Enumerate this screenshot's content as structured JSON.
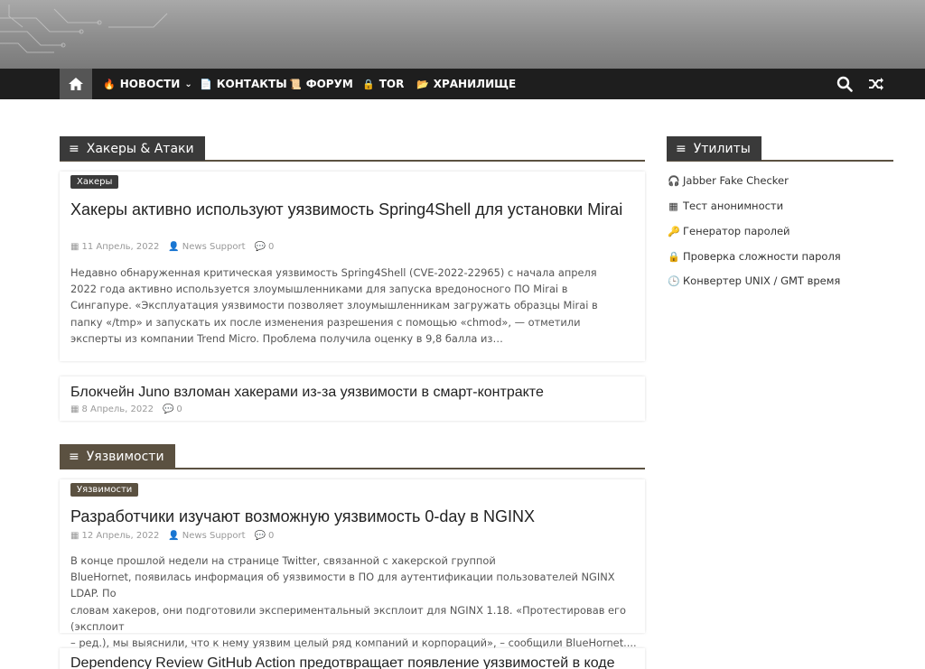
{
  "nav": {
    "items": [
      {
        "label": "НОВОСТИ",
        "icon": "fire-icon",
        "glyph": "🔥",
        "dropdown": "⌄"
      },
      {
        "label": "КОНТАКТЫ",
        "icon": "document-icon",
        "glyph": "📄"
      },
      {
        "label": "ФОРУМ",
        "icon": "scroll-icon",
        "glyph": "📜"
      },
      {
        "label": "TOR",
        "icon": "lock-icon",
        "glyph": "🔒"
      },
      {
        "label": "ХРАНИЛИЩЕ",
        "icon": "folder-icon",
        "glyph": "📂"
      }
    ]
  },
  "sections": [
    {
      "heading": "Хакеры & Атаки",
      "heading_icon": "≡",
      "posts": [
        {
          "category": "Хакеры",
          "title": "Хакеры активно используют уязвимость Spring4Shell для установки Mirai",
          "date": "11 Апрель, 2022",
          "author": "News Support",
          "comments": "0",
          "excerpt": "Недавно обнаруженная критическая уязвимость Spring4Shell (CVE-2022-22965) с начала апреля 2022 года активно используется злоумышленниками для запуска вредоносного ПО Mirai в Сингапуре. «Эксплуатация уязвимости позволяет злоумышленникам загружать образцы Mirai в папку «/tmp» и запускать их после изменения разрешения с помощью «chmod», — отметили эксперты из компании Trend Micro. Проблема получила оценку в 9,8 балла из…"
        },
        {
          "title": "Блокчейн Juno взломан хакерами из-за уязвимости в смарт-контракте",
          "date": "8 Апрель, 2022",
          "comments": "0"
        }
      ]
    },
    {
      "heading": "Уязвимости",
      "heading_icon": "≡",
      "posts": [
        {
          "category": "Уязвимости",
          "title": "Разработчики изучают возможную уязвимость 0-day в NGINX",
          "date": "12 Апрель, 2022",
          "author": "News Support",
          "comments": "0",
          "excerpt_lines": [
            "В конце прошлой недели на странице Twitter, связанной с хакерской группой",
            "BlueHornet, появилась информация об уязвимости в ПО для аутентификации пользователей NGINX LDAP. По",
            "словам хакеров, они подготовили экспериментальный эксплоит для NGINX 1.18. «Протестировав его (эксплоит",
            "– ред.), мы выяснили, что к нему уязвим целый ряд компаний и корпораций», – сообщили BlueHornet...."
          ]
        },
        {
          "title": "Dependency Review GitHub Action предотвращает появление уязвимостей в коде"
        }
      ]
    }
  ],
  "sidebar": {
    "heading": "Утилиты",
    "heading_icon": "≡",
    "links": [
      {
        "label": "Jabber Fake Checker",
        "icon": "headset-icon",
        "glyph": "🎧"
      },
      {
        "label": "Тест анонимности",
        "icon": "qr-icon",
        "glyph": "▦"
      },
      {
        "label": "Генератор паролей",
        "icon": "key-icon",
        "glyph": "🔑"
      },
      {
        "label": "Проверка сложности пароля",
        "icon": "lock-icon",
        "glyph": "🔒"
      },
      {
        "label": "Конвертер UNIX / GMT время",
        "icon": "clock-icon",
        "glyph": "🕒"
      }
    ]
  },
  "meta_icons": {
    "calendar": "▦",
    "user": "👤",
    "comment": "💬"
  },
  "colors": {
    "accent": "#5b5141",
    "nav_bg": "#1e1e1e",
    "heading_dark": "#3a3a3a"
  }
}
